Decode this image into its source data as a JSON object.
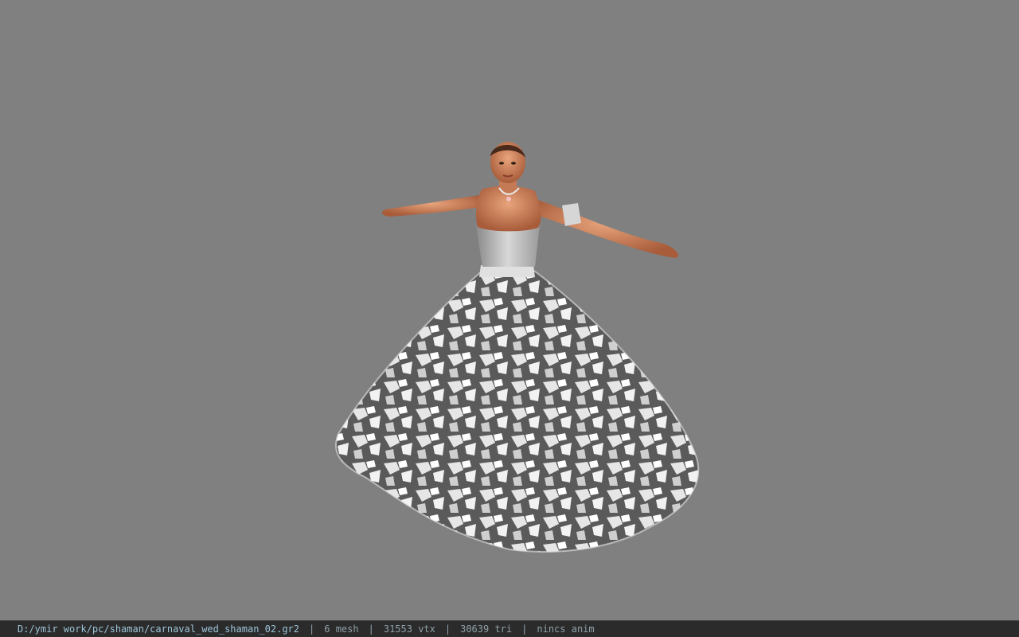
{
  "viewer": {
    "background_color": "#808080",
    "model_label": "character-model"
  },
  "status_bar": {
    "file_path": "D:/ymir work/pc/shaman/carnaval_wed_shaman_02.gr2",
    "separator": "|",
    "mesh_count": "6 mesh",
    "vertex_count": "31553 vtx",
    "triangle_count": "30639 tri",
    "anim_status": "nincs anim"
  }
}
